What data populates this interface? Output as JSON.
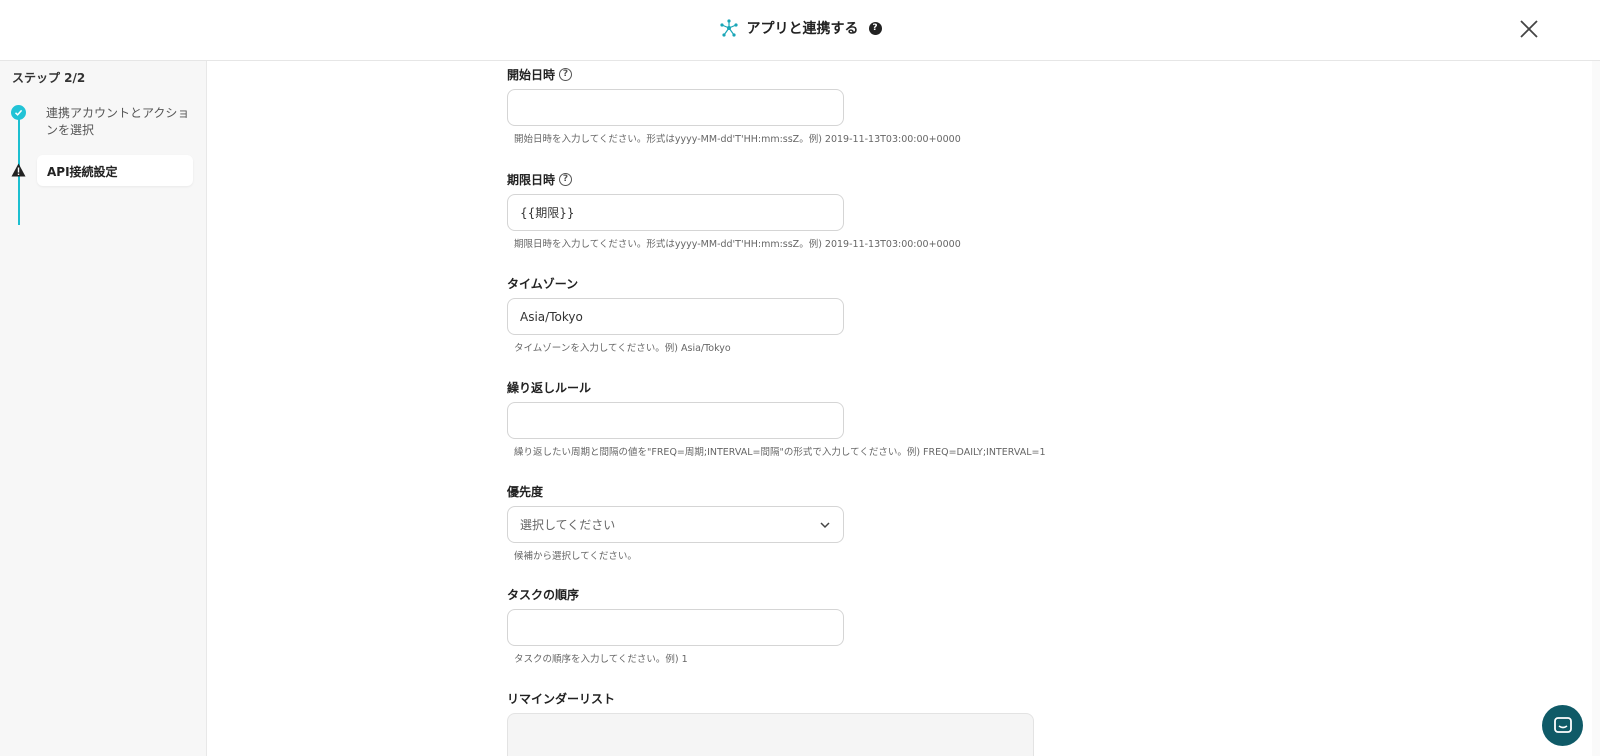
{
  "header": {
    "title": "アプリと連携する",
    "help": "?"
  },
  "sidebar": {
    "step_counter": "ステップ 2/2",
    "steps": [
      {
        "label": "連携アカウントとアクションを選択",
        "status": "done"
      },
      {
        "label": "API接続設定",
        "status": "warning"
      }
    ]
  },
  "form": {
    "start_datetime": {
      "label": "開始日時",
      "value": "",
      "hint": "開始日時を入力してください。形式はyyyy-MM-dd'T'HH:mm:ssZ。例) 2019-11-13T03:00:00+0000"
    },
    "due_datetime": {
      "label": "期限日時",
      "value": "{{期限}}",
      "hint": "期限日時を入力してください。形式はyyyy-MM-dd'T'HH:mm:ssZ。例) 2019-11-13T03:00:00+0000"
    },
    "timezone": {
      "label": "タイムゾーン",
      "value": "Asia/Tokyo",
      "hint": "タイムゾーンを入力してください。例) Asia/Tokyo"
    },
    "recurrence": {
      "label": "繰り返しルール",
      "value": "",
      "hint": "繰り返したい周期と間隔の値を\"FREQ=周期;INTERVAL=間隔\"の形式で入力してください。例) FREQ=DAILY;INTERVAL=1"
    },
    "priority": {
      "label": "優先度",
      "selected": "選択してください",
      "hint": "候補から選択してください。"
    },
    "task_order": {
      "label": "タスクの順序",
      "value": "",
      "hint": "タスクの順序を入力してください。例) 1"
    },
    "reminder_list": {
      "label": "リマインダーリスト"
    }
  },
  "colors": {
    "accent": "#22c3d6",
    "chat": "#0f5a67"
  }
}
